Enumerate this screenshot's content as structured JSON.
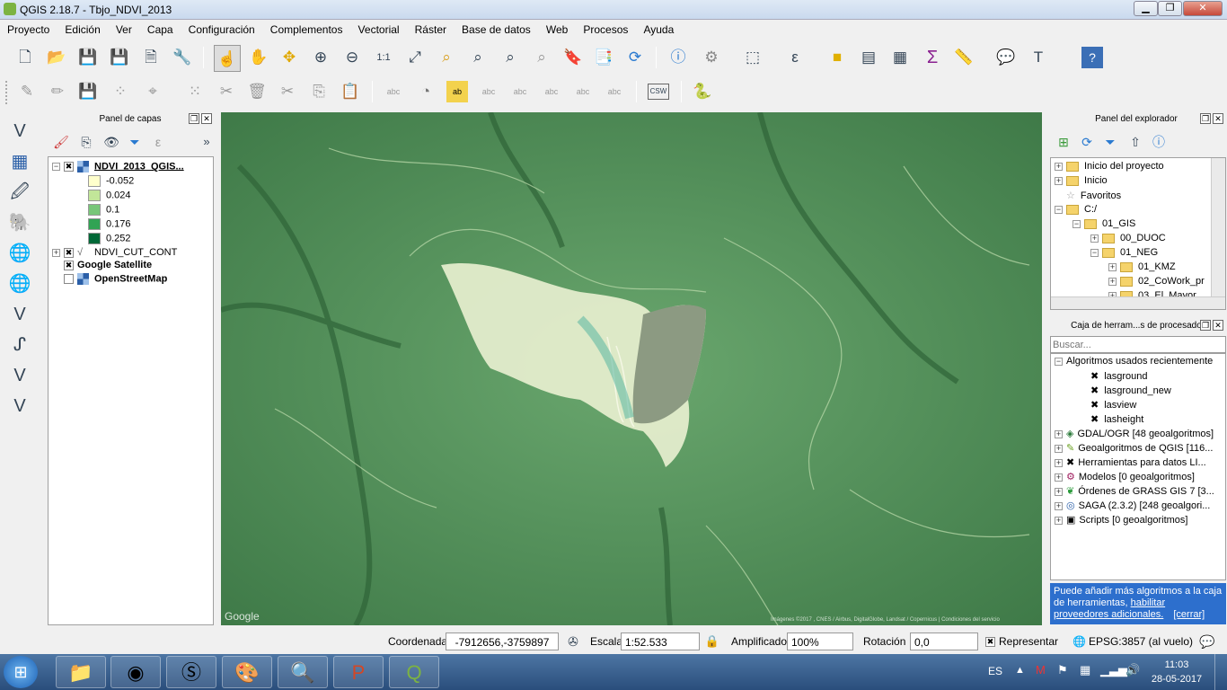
{
  "window": {
    "title": "QGIS 2.18.7 - Tbjo_NDVI_2013",
    "min": "▁",
    "max": "❐",
    "close": "✕"
  },
  "menu": [
    "Proyecto",
    "Edición",
    "Ver",
    "Capa",
    "Configuración",
    "Complementos",
    "Vectorial",
    "Ráster",
    "Base de datos",
    "Web",
    "Procesos",
    "Ayuda"
  ],
  "layers_panel": {
    "title": "Panel de capas",
    "float": "❐",
    "close": "✕",
    "more": "»",
    "layers": [
      {
        "name": "NDVI_2013_QGIS...",
        "checked": "✖",
        "expand": "−"
      },
      {
        "name": "NDVI_CUT_CONT",
        "checked": "✖",
        "expand": "+"
      },
      {
        "name": "Google Satellite",
        "checked": "✖"
      },
      {
        "name": "OpenStreetMap",
        "checked": ""
      }
    ],
    "legend": [
      {
        "value": "-0.052",
        "color": "#ffffcc"
      },
      {
        "value": "0.024",
        "color": "#c2e699"
      },
      {
        "value": "0.1",
        "color": "#78c679"
      },
      {
        "value": "0.176",
        "color": "#31a354"
      },
      {
        "value": "0.252",
        "color": "#006837"
      }
    ]
  },
  "browser_panel": {
    "title": "Panel del explorador",
    "float": "❐",
    "close": "✕",
    "items": [
      {
        "label": "Inicio del proyecto",
        "expand": "+"
      },
      {
        "label": "Inicio",
        "expand": "+"
      },
      {
        "label": "Favoritos",
        "expand": ""
      },
      {
        "label": "C:/",
        "expand": "−"
      },
      {
        "label": "01_GIS",
        "expand": "−"
      },
      {
        "label": "00_DUOC",
        "expand": "+"
      },
      {
        "label": "01_NEG",
        "expand": "−"
      },
      {
        "label": "01_KMZ",
        "expand": "+"
      },
      {
        "label": "02_CoWork_pr",
        "expand": "+"
      },
      {
        "label": "03_El_Mayor",
        "expand": "+"
      }
    ]
  },
  "toolbox_panel": {
    "title": "Caja de herram...s de procesado",
    "float": "❐",
    "close": "✕",
    "search_placeholder": "Buscar...",
    "recent": "Algoritmos usados recientemente",
    "recent_items": [
      "lasground",
      "lasground_new",
      "lasview",
      "lasheight"
    ],
    "groups": [
      "GDAL/OGR [48 geoalgoritmos]",
      "Geoalgoritmos de QGIS [116...",
      "Herramientas para datos LI...",
      "Modelos [0 geoalgoritmos]",
      "Órdenes de GRASS GIS 7 [3...",
      "SAGA (2.3.2) [248 geoalgori...",
      "Scripts [0 geoalgoritmos]"
    ],
    "info_text": "Puede añadir más algoritmos a la caja de herramientas,",
    "info_link1": "habilitar",
    "info_link2": "proveedores adicionales.",
    "info_cancel": "[cerrar]"
  },
  "map": {
    "watermark": "Google",
    "attribution": "Imágenes ©2017 , CNES / Airbus, DigitalGlobe, Landsat / Copernicus  |  Condiciones del servicio"
  },
  "status": {
    "coord_label": "Coordenada",
    "coord_value": "-7912656,-3759897",
    "scale_label": "Escala",
    "scale_value": "1:52.533",
    "magnifier_label": "Amplificador",
    "magnifier_value": "100%",
    "rotation_label": "Rotación",
    "rotation_value": "0,0",
    "render_label": "Representar",
    "render_checked": "✖",
    "crs": "EPSG:3857 (al vuelo)"
  },
  "taskbar": {
    "lang": "ES",
    "time": "11:03",
    "date": "28-05-2017"
  }
}
